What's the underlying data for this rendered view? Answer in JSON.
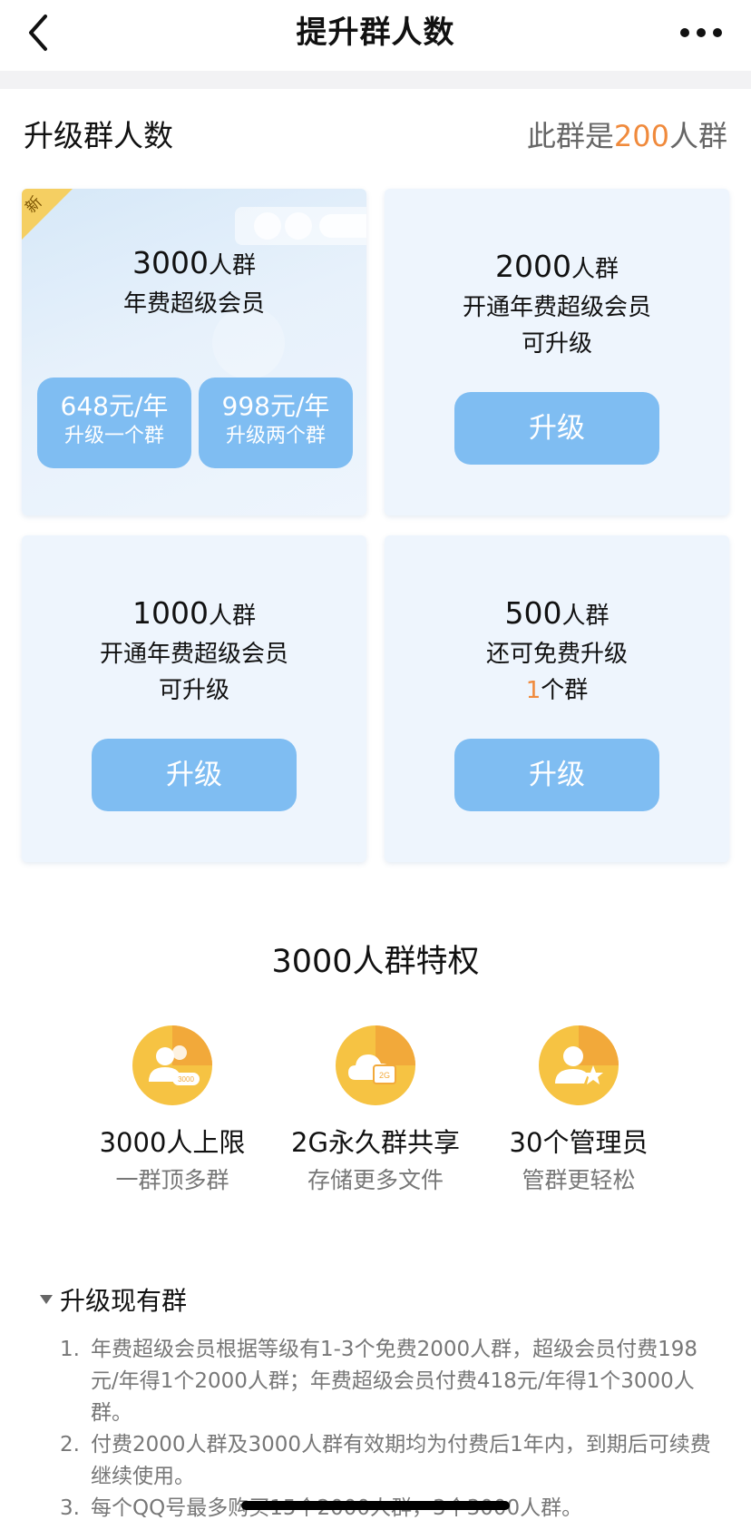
{
  "navbar": {
    "title": "提升群人数",
    "back_icon": "chevron-left-icon",
    "more_icon": "more-dots-icon"
  },
  "header": {
    "title": "升级群人数",
    "status_prefix": "此群是",
    "status_number": "200",
    "status_suffix": "人群"
  },
  "cards": {
    "c3000": {
      "badge": "新",
      "number": "3000",
      "unit": "人群",
      "subtitle": "年费超级会员",
      "options": [
        {
          "price": "648元/年",
          "label": "升级一个群"
        },
        {
          "price": "998元/年",
          "label": "升级两个群"
        }
      ]
    },
    "c2000": {
      "number": "2000",
      "unit": "人群",
      "line1": "开通年费超级会员",
      "line2": "可升级",
      "button": "升级"
    },
    "c1000": {
      "number": "1000",
      "unit": "人群",
      "line1": "开通年费超级会员",
      "line2": "可升级",
      "button": "升级"
    },
    "c500": {
      "number": "500",
      "unit": "人群",
      "line1": "还可免费升级",
      "line2_count": "1",
      "line2_suffix": "个群",
      "button": "升级"
    }
  },
  "privileges": {
    "title": "3000人群特权",
    "items": [
      {
        "icon": "group-members-icon",
        "icon_badge": "3000",
        "name": "3000人上限",
        "desc": "一群顶多群"
      },
      {
        "icon": "cloud-storage-icon",
        "icon_badge": "2G",
        "name": "2G永久群共享",
        "desc": "存储更多文件"
      },
      {
        "icon": "admin-star-icon",
        "name": "30个管理员",
        "desc": "管群更轻松"
      }
    ]
  },
  "notes": {
    "toggle_label": "升级现有群",
    "items": [
      {
        "num": "1.",
        "text": "年费超级会员根据等级有1-3个免费2000人群，超级会员付费198元/年得1个2000人群；年费超级会员付费418元/年得1个3000人群。"
      },
      {
        "num": "2.",
        "text": "付费2000人群及3000人群有效期均为付费后1年内，到期后可续费继续使用。"
      },
      {
        "num": "3.",
        "text": "每个QQ号最多购买15个2000人群，3个3000人群。"
      }
    ]
  },
  "colors": {
    "accent_orange": "#f08a3c",
    "button_blue": "#7fbdf2",
    "card_bg": "#eef5fd",
    "icon_yellow": "#f6b934"
  }
}
